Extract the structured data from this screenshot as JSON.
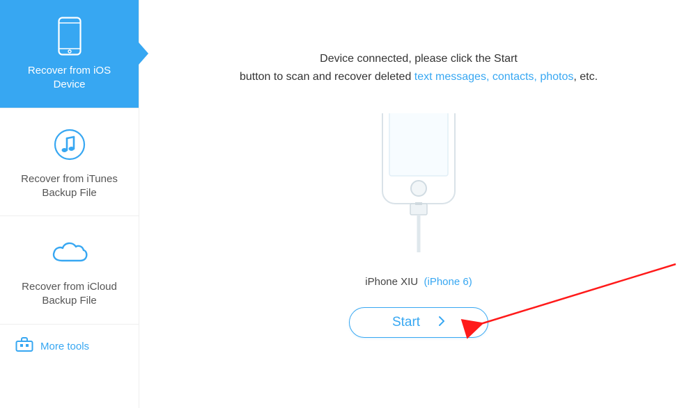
{
  "sidebar": {
    "items": [
      {
        "label": "Recover from iOS Device",
        "icon": "phone-icon",
        "active": true
      },
      {
        "label": "Recover from iTunes Backup File",
        "icon": "music-note-icon",
        "active": false
      },
      {
        "label": "Recover from iCloud Backup File",
        "icon": "cloud-icon",
        "active": false
      }
    ],
    "more_tools_label": "More tools"
  },
  "main": {
    "message_line1": "Device connected, please click the Start",
    "message_line2_prefix": "button to scan and recover deleted ",
    "message_links": "text messages, contacts, photos",
    "message_line2_suffix": ", etc.",
    "device_name": "iPhone XIU",
    "device_model": "(iPhone 6)",
    "start_label": "Start"
  },
  "colors": {
    "accent": "#37a7f2",
    "text": "#333333"
  }
}
